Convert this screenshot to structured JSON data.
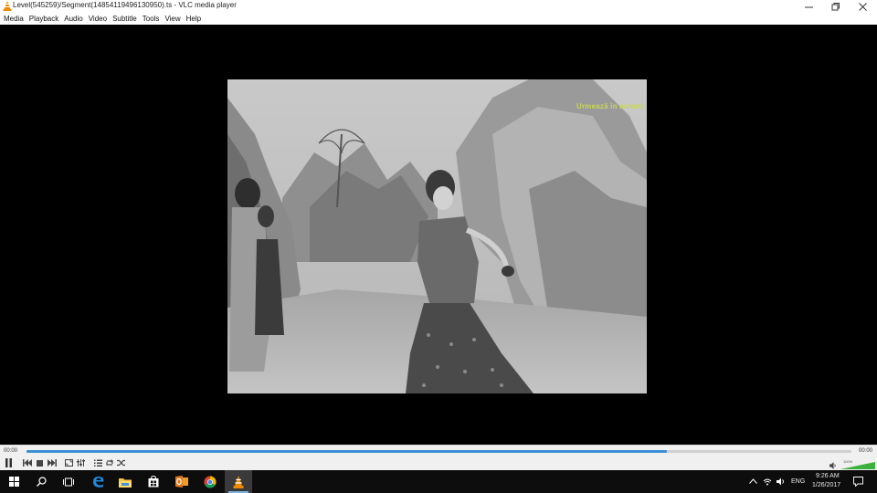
{
  "window": {
    "title": "Level(545259)/Segment(14854119496130950).ts - VLC media player"
  },
  "menu": [
    "Media",
    "Playback",
    "Audio",
    "Video",
    "Subtitle",
    "Tools",
    "View",
    "Help"
  ],
  "video": {
    "overlay_text": "Urmează în armată"
  },
  "controls": {
    "elapsed": "00:00",
    "total": "00:00",
    "progress": 0.776,
    "volume_label": "100%",
    "volume": 1.0
  },
  "taskbar": {
    "language": "ENG",
    "time": "9:26 AM",
    "date": "1/26/2017"
  },
  "colors": {
    "accent": "#3c8fd6",
    "vlc_orange": "#f08a00",
    "volume_green": "#3db13d"
  },
  "icons": [
    "vlc-cone-icon",
    "minimize-icon",
    "maximize-icon",
    "close-icon",
    "pause-icon",
    "previous-icon",
    "stop-icon",
    "next-icon",
    "fullscreen-icon",
    "extended-settings-icon",
    "playlist-icon",
    "loop-icon",
    "random-icon",
    "speaker-icon",
    "windows-start-icon",
    "search-icon",
    "task-view-icon",
    "edge-icon",
    "file-explorer-icon",
    "store-icon",
    "outlook-icon",
    "chrome-icon",
    "chevron-up-icon",
    "network-icon",
    "volume-icon",
    "notifications-icon"
  ]
}
